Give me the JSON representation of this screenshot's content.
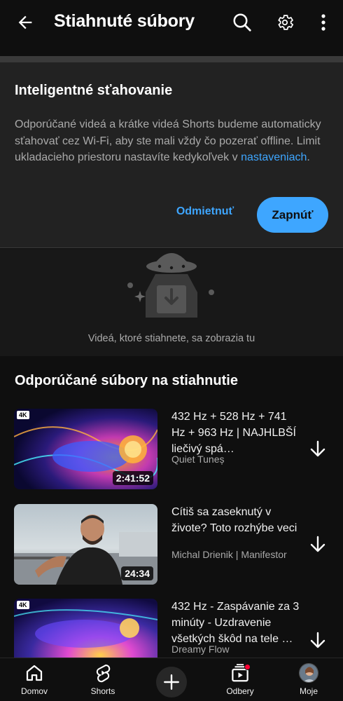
{
  "header": {
    "title": "Stiahnuté súbory",
    "back_icon": "arrow-left-icon",
    "search_icon": "search-icon",
    "settings_icon": "gear-icon",
    "more_icon": "more-vert-icon"
  },
  "smart_downloads": {
    "title": "Inteligentné sťahovanie",
    "description": "Odporúčané videá a krátke videá Shorts budeme automaticky sťahovať cez Wi-Fi, aby ste mali vždy čo pozerať offline. Limit ukladacieho priestoru nastavíte kedykoľvek v",
    "link_text": "nastaveniach",
    "trailing": ".",
    "dismiss_label": "Odmietnuť",
    "enable_label": "Zapnúť"
  },
  "empty_state": {
    "text": "Videá, ktoré stiahnete, sa zobrazia tu",
    "icon": "ufo-download-icon"
  },
  "recommended": {
    "title": "Odporúčané súbory na stiahnutie",
    "videos": [
      {
        "title": "432 Hz + 528 Hz + 741 Hz + 963 Hz | NAJHLBŠÍ liečivý spá…",
        "channel": "Quiet Tuneș",
        "duration": "2:41:52",
        "badge": "4K"
      },
      {
        "title": "Cítiš sa zaseknutý v živote? Toto rozhýbe veci",
        "channel": "Michal Drienik | Manifestor",
        "duration": "24:34",
        "badge": ""
      },
      {
        "title": "432 Hz - Zaspávanie za 3 minúty - Uzdravenie všetkých škôd na tele …",
        "channel": "Dreamy Flow",
        "duration": "",
        "badge": "4K"
      }
    ]
  },
  "bottom_nav": {
    "home": "Domov",
    "shorts": "Shorts",
    "subscriptions": "Odbery",
    "you": "Moje"
  },
  "colors": {
    "background": "#0f0f0f",
    "card": "#222222",
    "accent": "#3ea6ff",
    "secondary_text": "#aaaaaa",
    "notification": "#ff0033"
  }
}
